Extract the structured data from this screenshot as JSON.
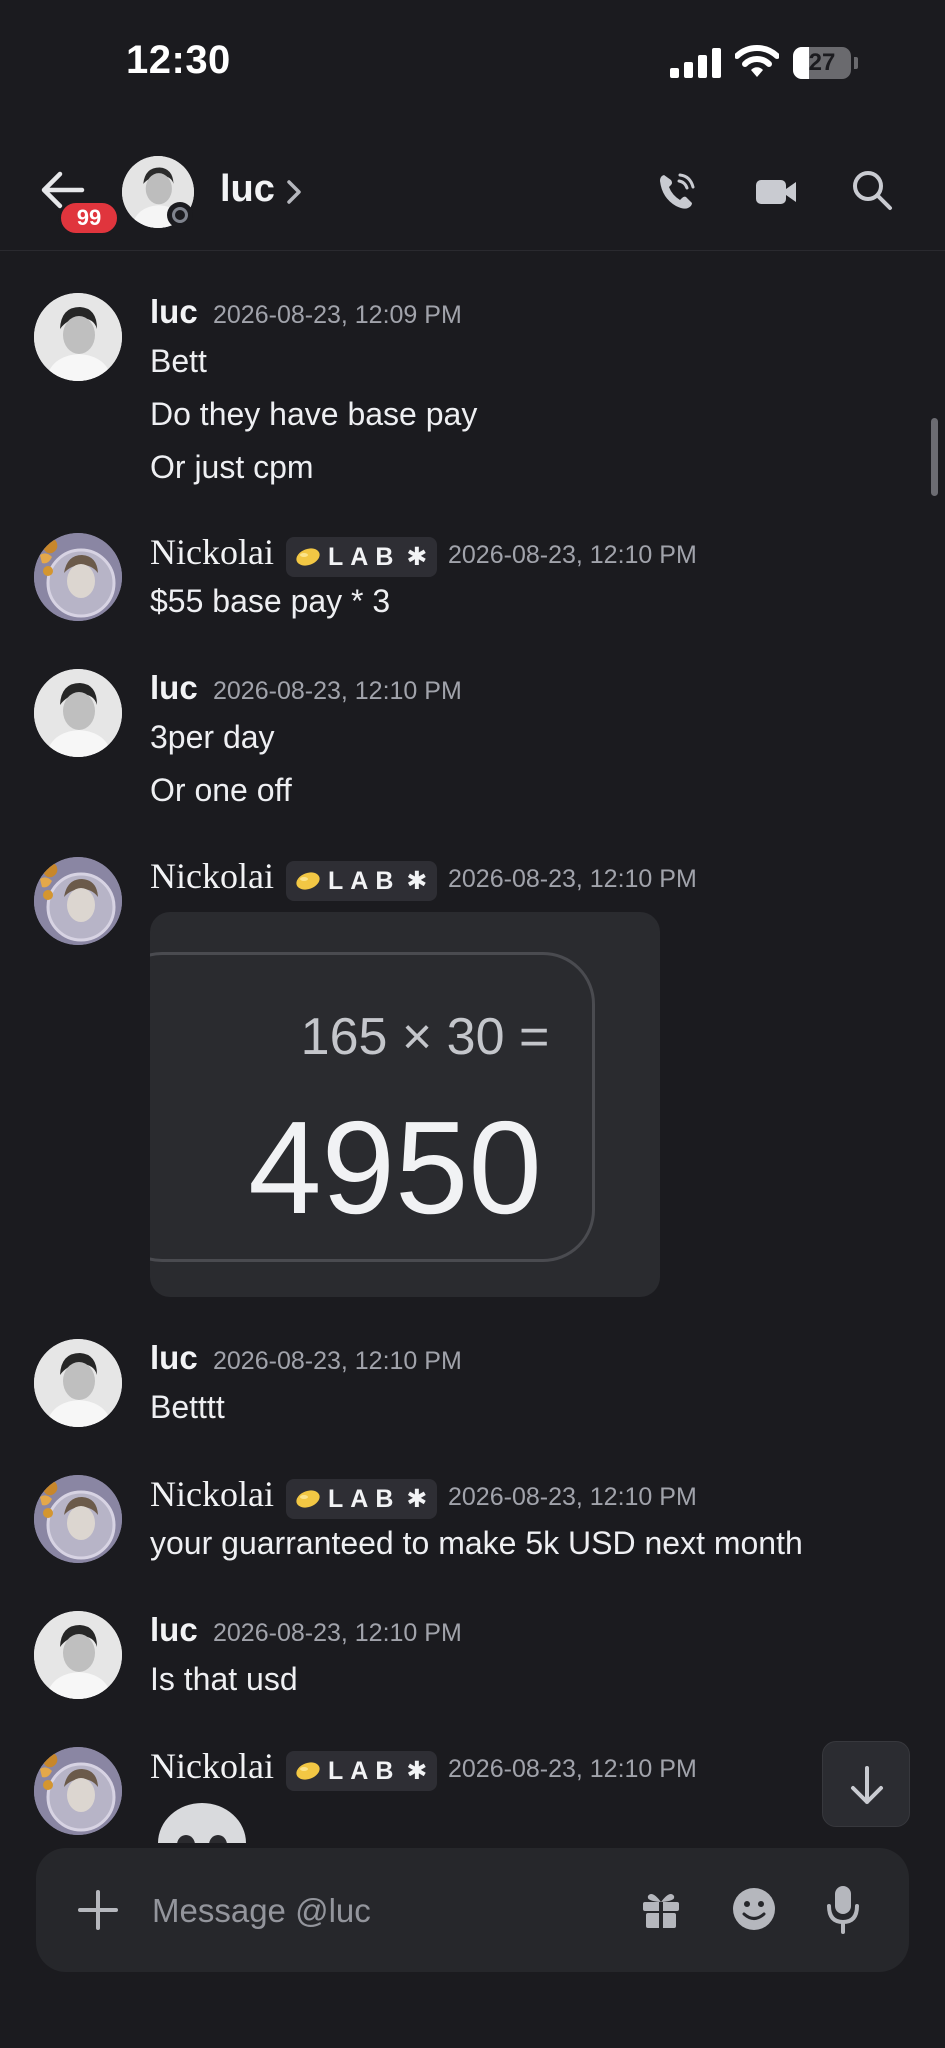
{
  "status_bar": {
    "time": "12:30",
    "battery": "27",
    "battery_fraction": 0.27
  },
  "header": {
    "unread_count": "99",
    "name": "luc"
  },
  "messages": [
    {
      "author": "luc",
      "timestamp": "2026-08-23, 12:09 PM",
      "lines": [
        "Bett",
        "Do they have base pay",
        "Or just cpm"
      ]
    },
    {
      "author": "Nickolai",
      "tag": "LAB",
      "timestamp": "2026-08-23, 12:10 PM",
      "lines": [
        "$55 base pay * 3"
      ]
    },
    {
      "author": "luc",
      "timestamp": "2026-08-23, 12:10 PM",
      "lines": [
        "3per day",
        "Or one off"
      ]
    },
    {
      "author": "Nickolai",
      "tag": "LAB",
      "timestamp": "2026-08-23, 12:10 PM",
      "image": {
        "equation": "165 × 30 =",
        "result": "4950"
      }
    },
    {
      "author": "luc",
      "timestamp": "2026-08-23, 12:10 PM",
      "lines": [
        "Betttt"
      ]
    },
    {
      "author": "Nickolai",
      "tag": "LAB",
      "timestamp": "2026-08-23, 12:10 PM",
      "lines": [
        "your guarranteed to make 5k USD next month"
      ]
    },
    {
      "author": "luc",
      "timestamp": "2026-08-23, 12:10 PM",
      "lines": [
        "Is that usd"
      ]
    },
    {
      "author": "Nickolai",
      "tag": "LAB",
      "timestamp": "2026-08-23, 12:10 PM",
      "lines": []
    }
  ],
  "composer": {
    "placeholder": "Message @luc"
  },
  "colors": {
    "background": "#1b1b1f",
    "badge": "#e0353d",
    "tag_bg": "#2e2e34",
    "timestamp": "#a1a3ab"
  },
  "icons": [
    "back-arrow-icon",
    "phone-call-icon",
    "video-camera-icon",
    "search-icon",
    "plus-icon",
    "gift-icon",
    "emoji-icon",
    "microphone-icon",
    "arrow-down-icon"
  ]
}
